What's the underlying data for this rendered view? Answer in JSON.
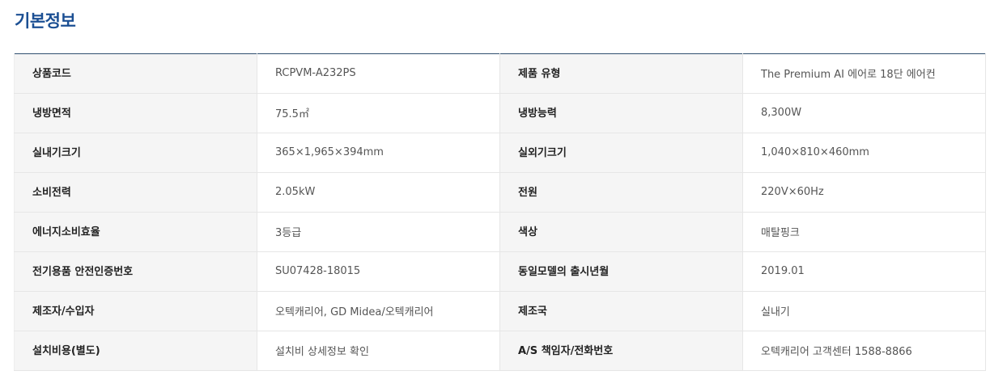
{
  "section": {
    "title": "기본정보"
  },
  "rows": [
    [
      {
        "label": "상품코드",
        "value": "RCPVM-A232PS"
      },
      {
        "label": "제품 유형",
        "value": "The Premium AI 에어로 18단 에어컨"
      }
    ],
    [
      {
        "label": "냉방면적",
        "value": "75.5㎡"
      },
      {
        "label": "냉방능력",
        "value": "8,300W"
      }
    ],
    [
      {
        "label": "실내기크기",
        "value": "365×1,965×394mm"
      },
      {
        "label": "실외기크기",
        "value": "1,040×810×460mm"
      }
    ],
    [
      {
        "label": "소비전력",
        "value": "2.05kW"
      },
      {
        "label": "전원",
        "value": "220V×60Hz"
      }
    ],
    [
      {
        "label": "에너지소비효율",
        "value": "3등급"
      },
      {
        "label": "색상",
        "value": "매탈핑크"
      }
    ],
    [
      {
        "label": "전기용품 안전인증번호",
        "value": "SU07428-18015"
      },
      {
        "label": "동일모델의 출시년월",
        "value": "2019.01"
      }
    ],
    [
      {
        "label": "제조자/수입자",
        "value": "오텍캐리어, GD Midea/오텍캐리어"
      },
      {
        "label": "제조국",
        "value": "실내기"
      }
    ],
    [
      {
        "label": "설치비용(별도)",
        "value": "설치비 상세정보 확인"
      },
      {
        "label": "A/S 책임자/전화번호",
        "value": "오텍캐리어 고객센터 1588-8866"
      }
    ]
  ]
}
